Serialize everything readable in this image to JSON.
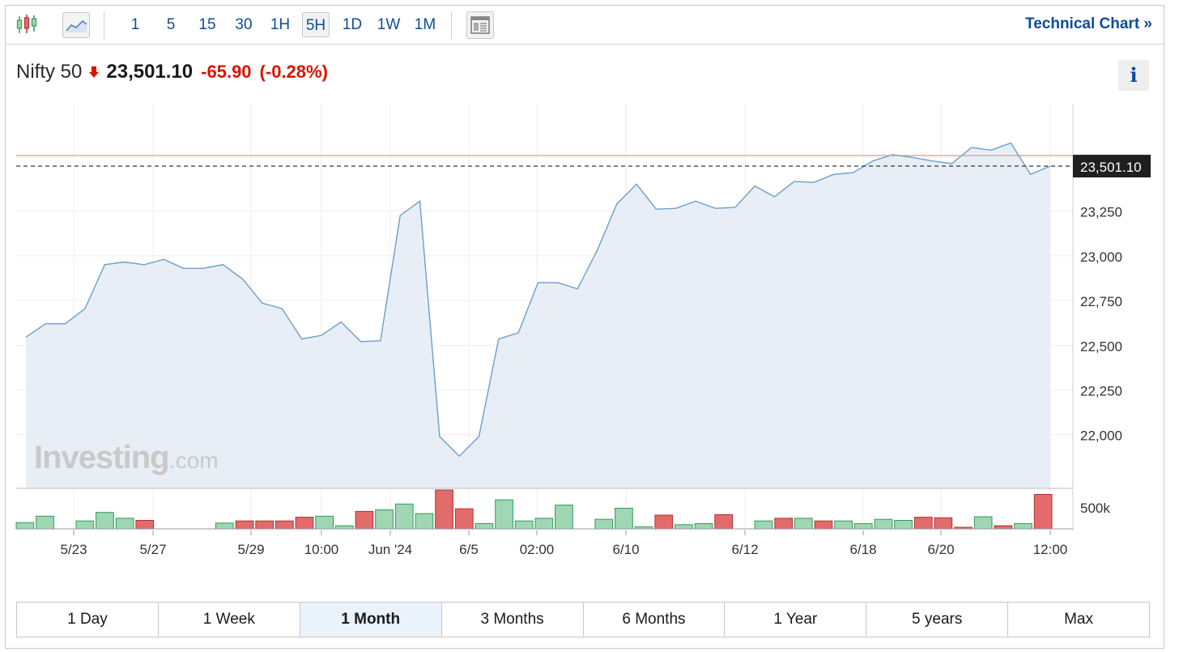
{
  "toolbar": {
    "candles_icon": "candlestick-icon",
    "area_icon": "area-chart-icon",
    "intervals": [
      "1",
      "5",
      "15",
      "30",
      "1H",
      "5H",
      "1D",
      "1W",
      "1M"
    ],
    "active_interval": "5H",
    "layout_icon": "layout-icon",
    "technical_chart_label": "Technical Chart »"
  },
  "quote": {
    "name": "Nifty 50",
    "price": "23,501.10",
    "change": "-65.90",
    "change_pct": "(-0.28%)",
    "direction": "down"
  },
  "info_label": "i",
  "watermark": {
    "brand": "Investing",
    "suffix": ".com"
  },
  "colors": {
    "up": "#9fd6b3",
    "up_border": "#2e9e57",
    "down": "#e26b6b",
    "down_border": "#b53030",
    "line": "#6a9fcb",
    "area": "#e8eef6",
    "negative_text": "#d91400",
    "link": "#0d4d98"
  },
  "chart_data": {
    "type": "area",
    "title": "Nifty 50",
    "ylim": [
      21700,
      23850
    ],
    "yticks": [
      "22,000",
      "22,250",
      "22,500",
      "22,750",
      "23,000",
      "23,250"
    ],
    "ytick_values": [
      22000,
      22250,
      22500,
      22750,
      23000,
      23250
    ],
    "xticks": [
      "5/23",
      "5/27",
      "5/29",
      "10:00",
      "Jun '24",
      "6/5",
      "02:00",
      "6/10",
      "6/12",
      "6/18",
      "6/20",
      "12:00"
    ],
    "last_price_label": "23,501.10",
    "last_price": 23501.1,
    "reference_line": 23560,
    "series": [
      {
        "values": [
          22545,
          22620,
          22620,
          22705,
          22950,
          22965,
          22950,
          22980,
          22930,
          22930,
          22950,
          22870,
          22735,
          22705,
          22535,
          22555,
          22630,
          22520,
          22525,
          23225,
          23305,
          21990,
          21880,
          21990,
          22535,
          22570,
          22850,
          22850,
          22815,
          23030,
          23290,
          23400,
          23260,
          23265,
          23305,
          23265,
          23270,
          23390,
          23330,
          23415,
          23410,
          23455,
          23465,
          23530,
          23565,
          23550,
          23530,
          23515,
          23605,
          23590,
          23630,
          23455,
          23501
        ]
      }
    ],
    "volume": {
      "axis_label": "500k",
      "max": 750000,
      "bars": [
        {
          "v": 120000,
          "dir": "up"
        },
        {
          "v": 240000,
          "dir": "up"
        },
        {
          "v": 0,
          "dir": "up"
        },
        {
          "v": 150000,
          "dir": "up"
        },
        {
          "v": 310000,
          "dir": "up"
        },
        {
          "v": 200000,
          "dir": "up"
        },
        {
          "v": 160000,
          "dir": "down"
        },
        {
          "v": 0,
          "dir": "up"
        },
        {
          "v": 0,
          "dir": "up"
        },
        {
          "v": 0,
          "dir": "up"
        },
        {
          "v": 110000,
          "dir": "up"
        },
        {
          "v": 150000,
          "dir": "down"
        },
        {
          "v": 150000,
          "dir": "down"
        },
        {
          "v": 150000,
          "dir": "down"
        },
        {
          "v": 220000,
          "dir": "down"
        },
        {
          "v": 240000,
          "dir": "up"
        },
        {
          "v": 60000,
          "dir": "up"
        },
        {
          "v": 330000,
          "dir": "down"
        },
        {
          "v": 360000,
          "dir": "up"
        },
        {
          "v": 470000,
          "dir": "up"
        },
        {
          "v": 290000,
          "dir": "up"
        },
        {
          "v": 880000,
          "dir": "down"
        },
        {
          "v": 380000,
          "dir": "down"
        },
        {
          "v": 100000,
          "dir": "up"
        },
        {
          "v": 550000,
          "dir": "up"
        },
        {
          "v": 150000,
          "dir": "up"
        },
        {
          "v": 200000,
          "dir": "up"
        },
        {
          "v": 450000,
          "dir": "up"
        },
        {
          "v": 0,
          "dir": "up"
        },
        {
          "v": 180000,
          "dir": "up"
        },
        {
          "v": 390000,
          "dir": "up"
        },
        {
          "v": 40000,
          "dir": "up"
        },
        {
          "v": 260000,
          "dir": "down"
        },
        {
          "v": 80000,
          "dir": "up"
        },
        {
          "v": 100000,
          "dir": "up"
        },
        {
          "v": 270000,
          "dir": "down"
        },
        {
          "v": 0,
          "dir": "up"
        },
        {
          "v": 150000,
          "dir": "up"
        },
        {
          "v": 200000,
          "dir": "down"
        },
        {
          "v": 200000,
          "dir": "up"
        },
        {
          "v": 150000,
          "dir": "down"
        },
        {
          "v": 150000,
          "dir": "up"
        },
        {
          "v": 100000,
          "dir": "up"
        },
        {
          "v": 180000,
          "dir": "up"
        },
        {
          "v": 160000,
          "dir": "up"
        },
        {
          "v": 220000,
          "dir": "down"
        },
        {
          "v": 210000,
          "dir": "down"
        },
        {
          "v": 30000,
          "dir": "down"
        },
        {
          "v": 230000,
          "dir": "up"
        },
        {
          "v": 60000,
          "dir": "down"
        },
        {
          "v": 100000,
          "dir": "up"
        },
        {
          "v": 650000,
          "dir": "down"
        }
      ]
    }
  },
  "ranges": {
    "items": [
      "1 Day",
      "1 Week",
      "1 Month",
      "3 Months",
      "6 Months",
      "1 Year",
      "5 years",
      "Max"
    ],
    "active": "1 Month"
  }
}
